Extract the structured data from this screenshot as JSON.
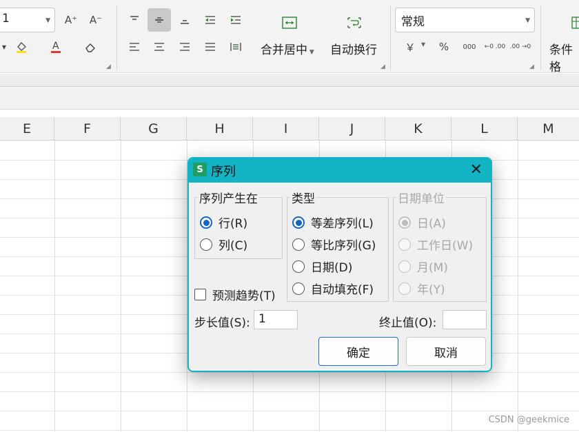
{
  "ribbon": {
    "font_size_value": "1",
    "font_inc_glyph": "A⁺",
    "font_dec_glyph": "A⁻",
    "merge_center_label": "合并居中",
    "wrap_text_label": "自动换行",
    "number_format_value": "常规",
    "currency_glyph": "￥",
    "percent_glyph": "%",
    "thousands_glyph": "000",
    "dec_inc_glyph": "←0 .00",
    "dec_dec_glyph": ".00 →0",
    "conditional_format_label": "条件格"
  },
  "sheet": {
    "columns": [
      "E",
      "F",
      "G",
      "H",
      "I",
      "J",
      "K",
      "L",
      "M"
    ]
  },
  "dialog": {
    "app_logo_text": "S",
    "title": "序列",
    "close_glyph": "✕",
    "series_in": {
      "legend": "序列产生在",
      "options": [
        "行(R)",
        "列(C)"
      ],
      "selected": "行(R)"
    },
    "type": {
      "legend": "类型",
      "options": [
        "等差序列(L)",
        "等比序列(G)",
        "日期(D)",
        "自动填充(F)"
      ],
      "selected": "等差序列(L)"
    },
    "date_unit": {
      "legend": "日期单位",
      "options": [
        "日(A)",
        "工作日(W)",
        "月(M)",
        "年(Y)"
      ],
      "selected": "日(A)",
      "disabled": true
    },
    "trend_label": "预测趋势(T)",
    "trend_checked": false,
    "step_label": "步长值(S):",
    "step_value": "1",
    "stop_label": "终止值(O):",
    "stop_value": "",
    "ok_label": "确定",
    "cancel_label": "取消"
  },
  "watermark": "CSDN @geekmice",
  "colors": {
    "dialog_accent": "#12b3c3",
    "radio_selected": "#1565c0",
    "app_logo": "#1f9d63"
  }
}
